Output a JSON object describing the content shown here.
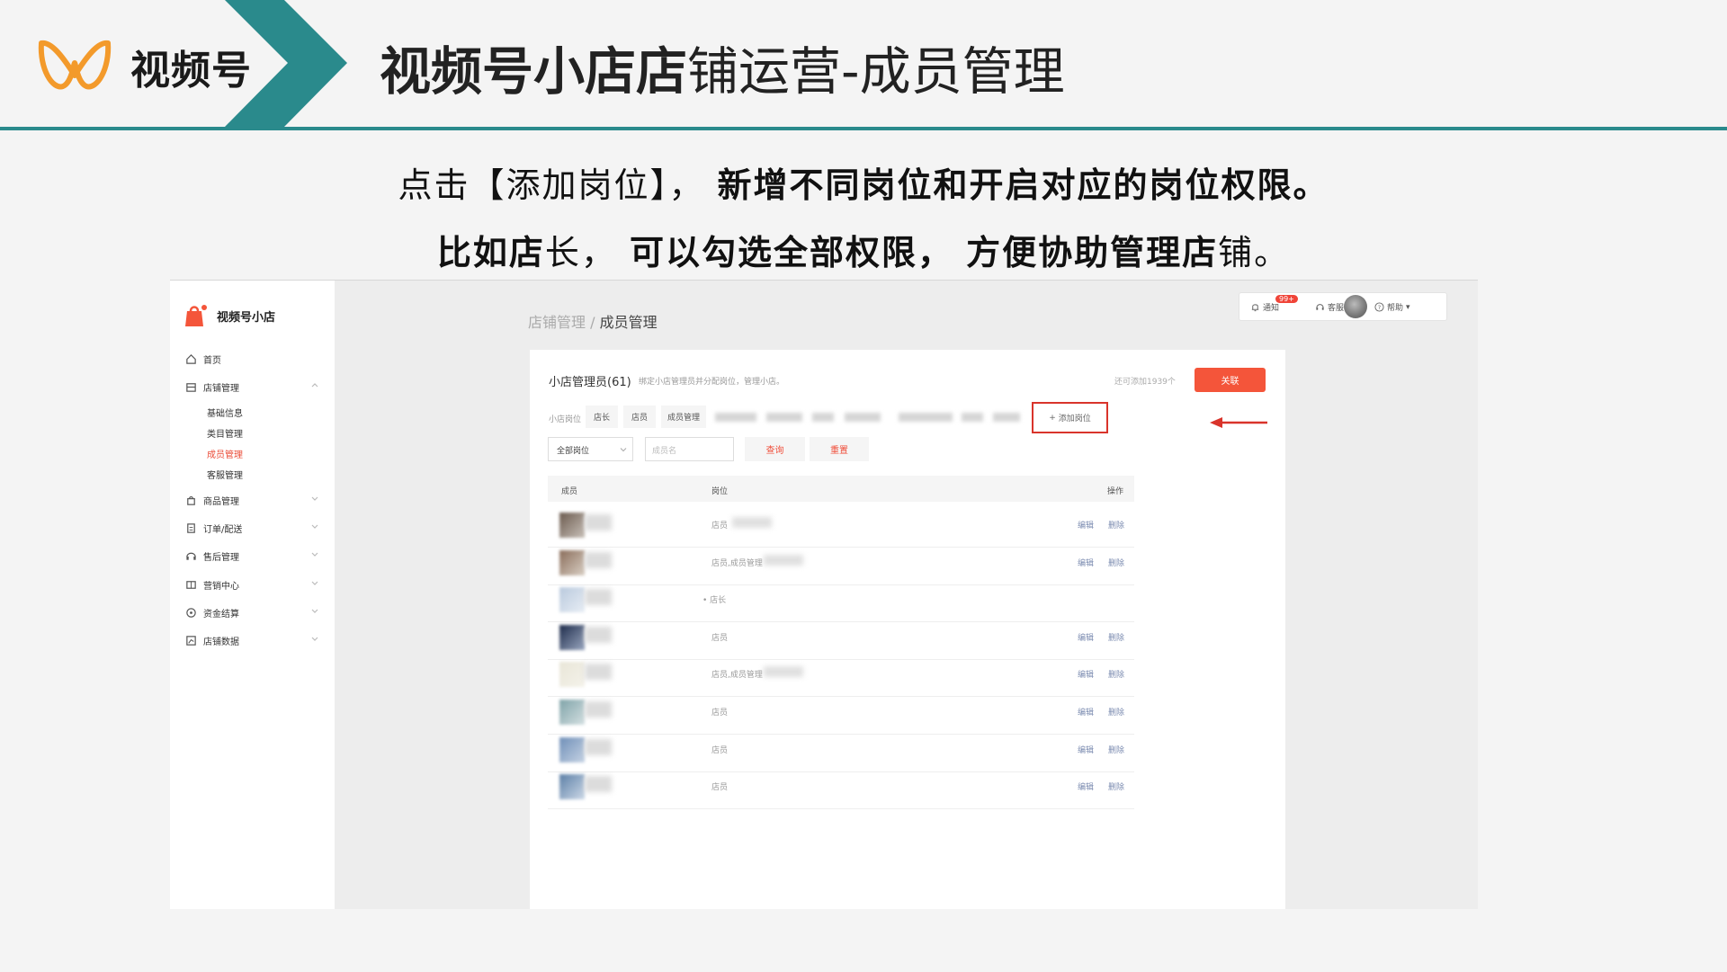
{
  "slide": {
    "brand": "视频号",
    "title_bold": "视频号小店店",
    "title_regular": "铺运营-成员管理",
    "accent_color": "#2a8a8c",
    "logo_color": "#f39a2b"
  },
  "instructions": {
    "line1_a": "点击【添加岗位】，",
    "line1_b": "新增不同岗位和开启对应的岗位权限。",
    "line2_a": "比如",
    "line2_b": "店",
    "line2_c": "长，",
    "line2_d": "可以勾选全部权限，",
    "line2_e": "方便协助管理",
    "line2_f": "店",
    "line2_g": "铺。"
  },
  "app": {
    "shop_name": "视频号小店",
    "nav": [
      {
        "label": "首页",
        "icon": "home-icon"
      },
      {
        "label": "店铺管理",
        "icon": "store-icon"
      },
      {
        "label": "商品管理",
        "icon": "bag-icon"
      },
      {
        "label": "订单/配送",
        "icon": "order-icon"
      },
      {
        "label": "售后管理",
        "icon": "service-icon"
      },
      {
        "label": "营销中心",
        "icon": "marketing-icon"
      },
      {
        "label": "资金结算",
        "icon": "money-icon"
      },
      {
        "label": "店铺数据",
        "icon": "chart-icon"
      }
    ],
    "store_sub": [
      "基础信息",
      "类目管理",
      "成员管理",
      "客服管理"
    ],
    "active_sub": "成员管理",
    "breadcrumb": {
      "parent": "店铺管理",
      "sep": "/",
      "current": "成员管理"
    },
    "topbar": {
      "notify": "通知",
      "badge": "99+",
      "service": "客服",
      "help": "帮助"
    },
    "card": {
      "title": "小店管理员(61)",
      "desc": "绑定小店管理员并分配岗位，管理小店。",
      "quota": "还可添加1939个",
      "assoc_button": "关联",
      "role_label": "小店岗位",
      "role_tags": [
        "店长",
        "店员",
        "成员管理"
      ],
      "add_role_button": "添加岗位",
      "filter_select": "全部岗位",
      "member_placeholder": "成员名",
      "query_button": "查询",
      "reset_button": "重置",
      "columns": {
        "member": "成员",
        "role": "岗位",
        "action": "操作"
      },
      "edit_label": "编辑",
      "delete_label": "删除",
      "rows": [
        {
          "role": "店员",
          "extra": true,
          "actions": true
        },
        {
          "role": "店员,成员管理",
          "extra": true,
          "actions": true
        },
        {
          "role": "• 店长",
          "extra": false,
          "actions": false
        },
        {
          "role": "店员",
          "extra": false,
          "actions": true
        },
        {
          "role": "店员,成员管理",
          "extra": true,
          "actions": true
        },
        {
          "role": "店员",
          "extra": false,
          "actions": true
        },
        {
          "role": "店员",
          "extra": false,
          "actions": true
        },
        {
          "role": "店员",
          "extra": false,
          "actions": true
        }
      ]
    },
    "brand_color": "#f4553a",
    "highlight_color": "#d9342b"
  }
}
